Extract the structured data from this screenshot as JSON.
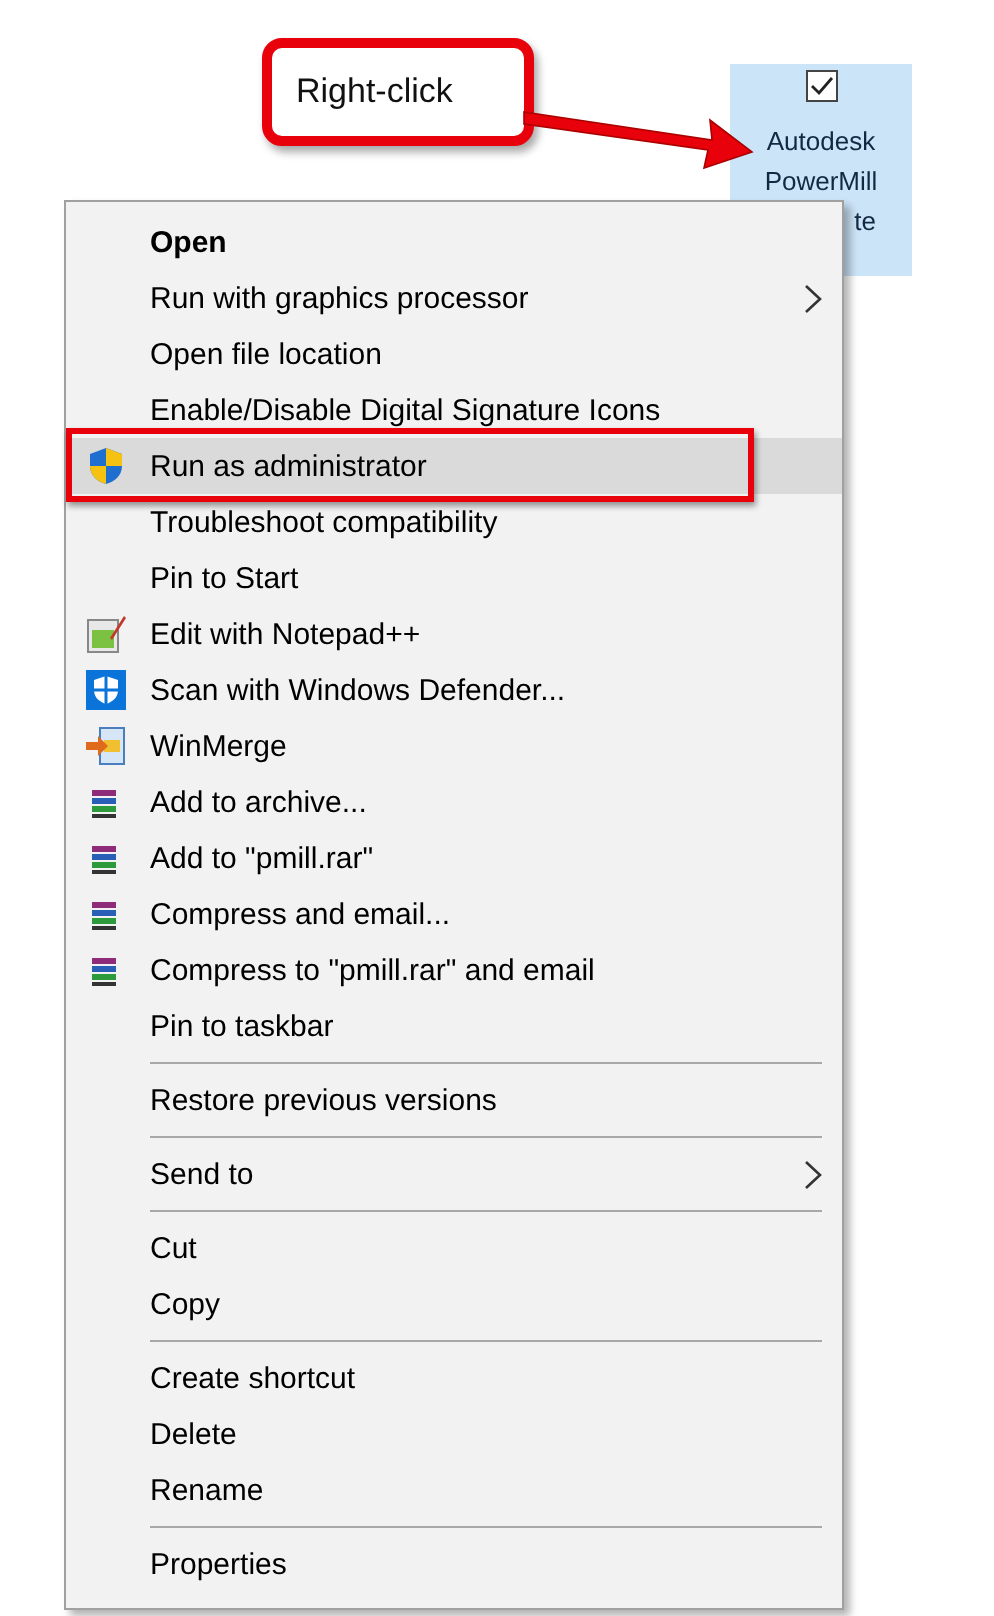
{
  "callout": {
    "text": "Right-click"
  },
  "desktop_icon": {
    "selected": true,
    "checked": true,
    "label_lines": [
      "Autodesk",
      "PowerMill",
      "te"
    ]
  },
  "menu": {
    "items": [
      {
        "kind": "plain",
        "label": "Open",
        "bold": true,
        "submenu": false,
        "selected": false
      },
      {
        "kind": "plain",
        "label": "Run with graphics processor",
        "bold": false,
        "submenu": true,
        "selected": false
      },
      {
        "kind": "plain",
        "label": "Open file location",
        "bold": false,
        "submenu": false,
        "selected": false
      },
      {
        "kind": "plain",
        "label": "Enable/Disable Digital Signature Icons",
        "bold": false,
        "submenu": false,
        "selected": false
      },
      {
        "kind": "shield",
        "label": "Run as administrator",
        "bold": false,
        "submenu": false,
        "selected": true,
        "outlined": true
      },
      {
        "kind": "plain",
        "label": "Troubleshoot compatibility",
        "bold": false,
        "submenu": false,
        "selected": false
      },
      {
        "kind": "plain",
        "label": "Pin to Start",
        "bold": false,
        "submenu": false,
        "selected": false
      },
      {
        "kind": "notepad",
        "label": "Edit with Notepad++",
        "bold": false,
        "submenu": false,
        "selected": false
      },
      {
        "kind": "defender",
        "label": "Scan with Windows Defender...",
        "bold": false,
        "submenu": false,
        "selected": false
      },
      {
        "kind": "merge",
        "label": "WinMerge",
        "bold": false,
        "submenu": false,
        "selected": false
      },
      {
        "kind": "archive",
        "label": "Add to archive...",
        "bold": false,
        "submenu": false,
        "selected": false
      },
      {
        "kind": "archive",
        "label": "Add to \"pmill.rar\"",
        "bold": false,
        "submenu": false,
        "selected": false
      },
      {
        "kind": "archive",
        "label": "Compress and email...",
        "bold": false,
        "submenu": false,
        "selected": false
      },
      {
        "kind": "archive",
        "label": "Compress to \"pmill.rar\" and email",
        "bold": false,
        "submenu": false,
        "selected": false
      },
      {
        "kind": "plain",
        "label": "Pin to taskbar",
        "bold": false,
        "submenu": false,
        "selected": false
      },
      {
        "kind": "separator"
      },
      {
        "kind": "plain",
        "label": "Restore previous versions",
        "bold": false,
        "submenu": false,
        "selected": false
      },
      {
        "kind": "separator"
      },
      {
        "kind": "plain",
        "label": "Send to",
        "bold": false,
        "submenu": true,
        "selected": false
      },
      {
        "kind": "separator"
      },
      {
        "kind": "plain",
        "label": "Cut",
        "bold": false,
        "submenu": false,
        "selected": false
      },
      {
        "kind": "plain",
        "label": "Copy",
        "bold": false,
        "submenu": false,
        "selected": false
      },
      {
        "kind": "separator"
      },
      {
        "kind": "plain",
        "label": "Create shortcut",
        "bold": false,
        "submenu": false,
        "selected": false
      },
      {
        "kind": "plain",
        "label": "Delete",
        "bold": false,
        "submenu": false,
        "selected": false
      },
      {
        "kind": "plain",
        "label": "Rename",
        "bold": false,
        "submenu": false,
        "selected": false
      },
      {
        "kind": "separator"
      },
      {
        "kind": "plain",
        "label": "Properties",
        "bold": false,
        "submenu": false,
        "selected": false
      }
    ]
  }
}
